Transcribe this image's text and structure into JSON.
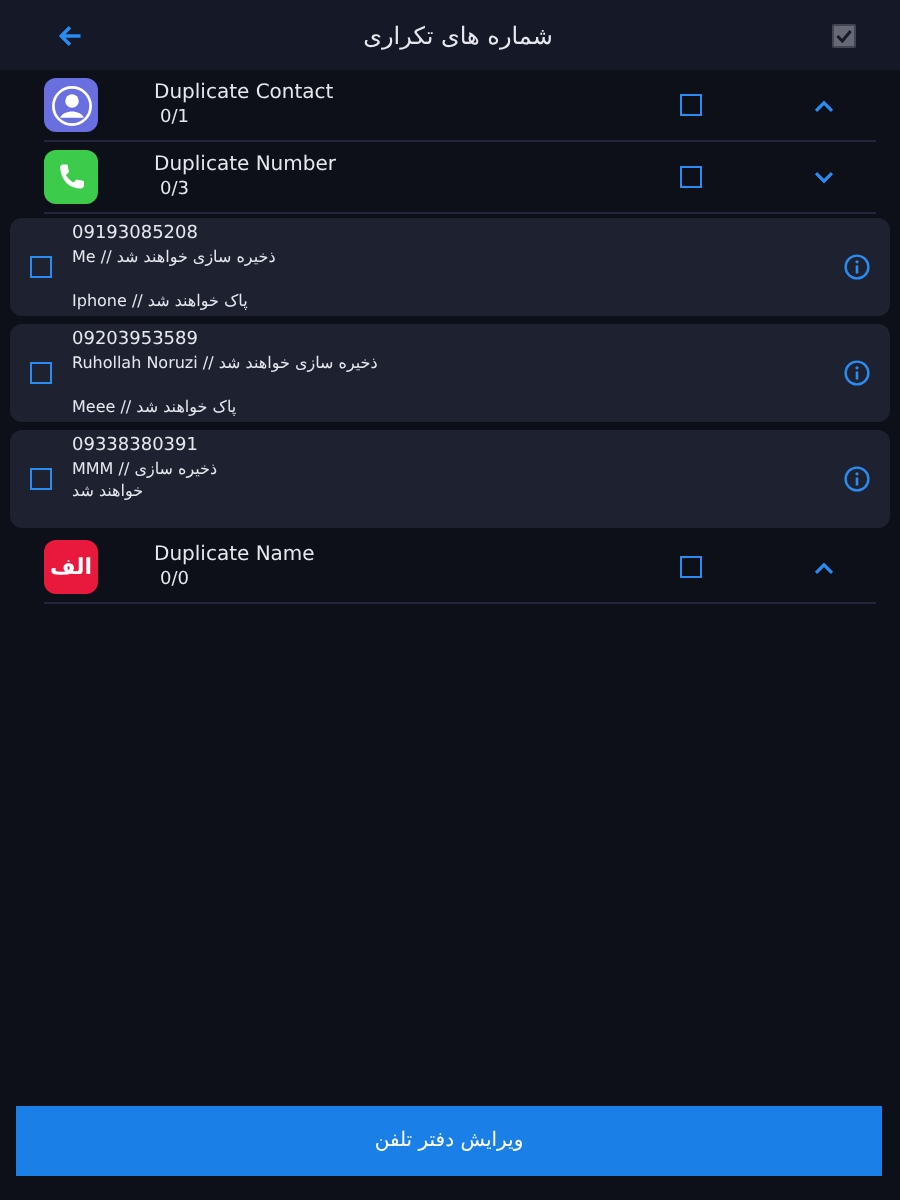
{
  "header": {
    "title": "شماره های تکراری",
    "select_all": {
      "checked": true,
      "disabled": true
    }
  },
  "groups": [
    {
      "kind": "contact",
      "title": "Duplicate Contact",
      "count": "0/1",
      "checked": false,
      "expanded": false
    },
    {
      "kind": "phone",
      "title": "Duplicate Number",
      "count": "0/3",
      "checked": false,
      "expanded": true,
      "items": [
        {
          "number": "09193085208",
          "save_lines": [
            "Me // ذخیره سازی خواهند شد"
          ],
          "delete_line": "Iphone // پاک خواهند شد",
          "checked": false
        },
        {
          "number": "09203953589",
          "save_lines": [
            "Ruhollah Noruzi // ذخیره سازی خواهند شد"
          ],
          "delete_line": "Meee // پاک خواهند شد",
          "checked": false
        },
        {
          "number": "09338380391",
          "save_lines": [
            "MMM // ذخیره سازی",
            "خواهند شد"
          ],
          "checked": false
        }
      ]
    },
    {
      "kind": "letter",
      "icon_text": "الف",
      "title": "Duplicate Name",
      "count": "0/0",
      "checked": false,
      "expanded": false
    }
  ],
  "action_button": "ویرایش دفتر تلفن"
}
